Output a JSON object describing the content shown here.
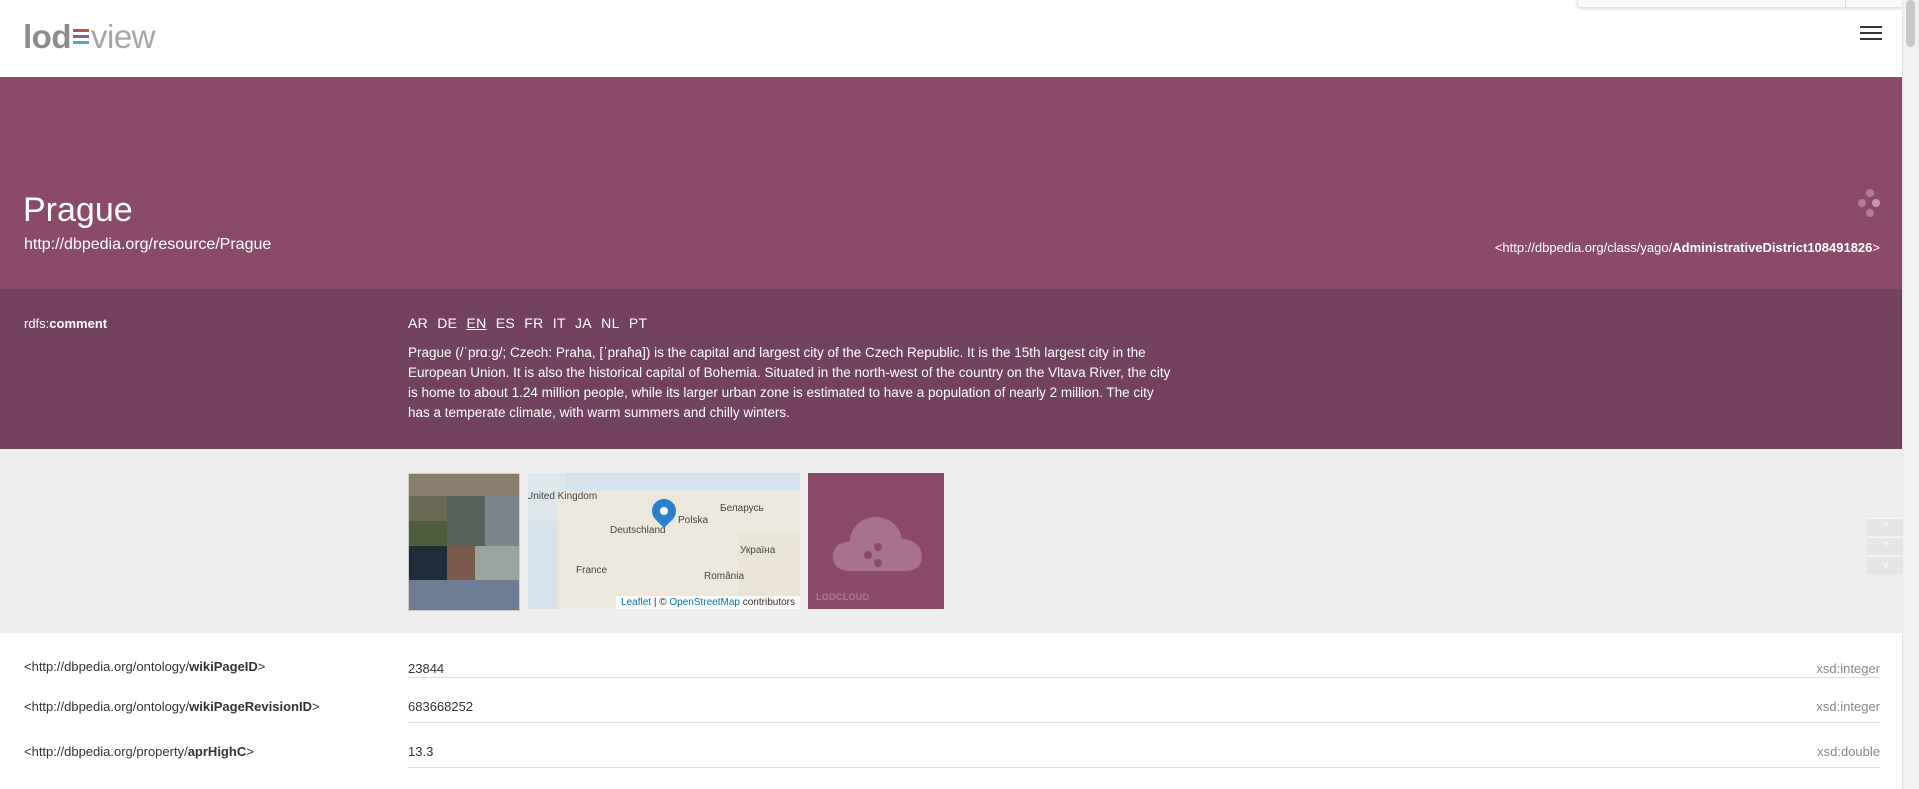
{
  "logo": {
    "part1": "lod",
    "part2": "view",
    "colors": [
      "#c0504d",
      "#8064a2",
      "#4bacc6"
    ]
  },
  "hero": {
    "title": "Prague",
    "uri": "http://dbpedia.org/resource/Prague",
    "type_prefix": "<http://dbpedia.org/class/yago/",
    "type_local": "AdministrativeDistrict108491826",
    "type_suffix": ">"
  },
  "comment": {
    "prop_prefix": "rdfs:",
    "prop_local": "comment",
    "languages": [
      "AR",
      "DE",
      "EN",
      "ES",
      "FR",
      "IT",
      "JA",
      "NL",
      "PT"
    ],
    "selected_language": "EN",
    "text": "Prague (/ˈprɑːɡ/; Czech: Praha, [ˈpraɦa]) is the capital and largest city of the Czech Republic. It is the 15th largest city in the European Union. It is also the historical capital of Bohemia. Situated in the north-west of the country on the Vltava River, the city is home to about 1.24 million people, while its larger urban zone is estimated to have a population of nearly 2 million. The city has a temperate climate, with warm summers and chilly winters."
  },
  "media": {
    "map": {
      "labels": [
        "United Kingdom",
        "Deutschland",
        "Polska",
        "Беларусь",
        "Україна",
        "France",
        "România"
      ],
      "attr_link1": "Leaflet",
      "attr_sep": " | © ",
      "attr_link2": "OpenStreetMap",
      "attr_suffix": " contributors"
    },
    "lodcloud_label": "LODCLOUD"
  },
  "rows": [
    {
      "prefix": "<http://dbpedia.org/ontology/",
      "local": "wikiPageID",
      "suffix": ">",
      "value": "23844",
      "datatype": "xsd:integer"
    },
    {
      "prefix": "<http://dbpedia.org/ontology/",
      "local": "wikiPageRevisionID",
      "suffix": ">",
      "value": "683668252",
      "datatype": "xsd:integer"
    },
    {
      "prefix": "<http://dbpedia.org/property/",
      "local": "aprHighC",
      "suffix": ">",
      "value": "13.3",
      "datatype": "xsd:double"
    }
  ],
  "nav": {
    "up_icon": "^",
    "top_icon": "⤒",
    "down_icon": "v"
  },
  "colors": {
    "hero": "#8a4b6b",
    "comment": "#734260",
    "media_bg": "#ededed"
  }
}
